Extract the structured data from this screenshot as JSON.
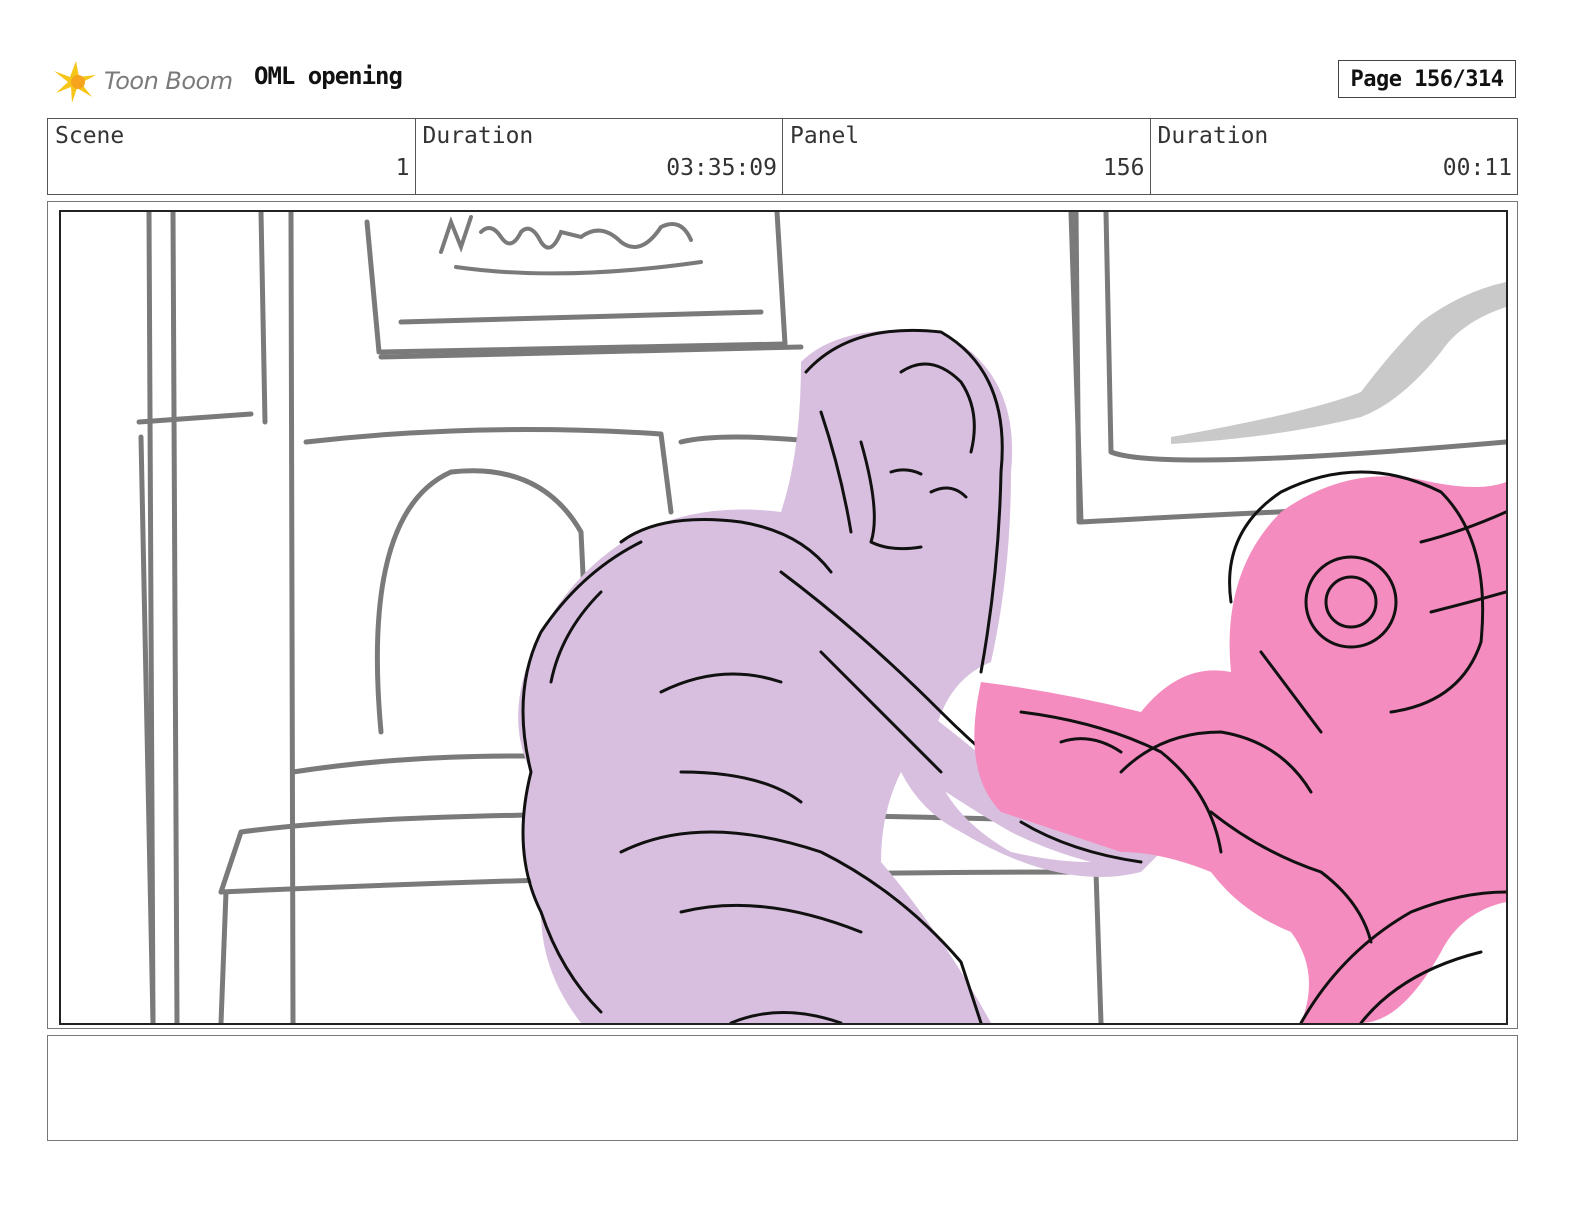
{
  "header": {
    "logo_text": "Toon Boom",
    "logo_icon": "toon-boom-burst-icon",
    "project_title": "OML opening",
    "page_label": "Page 156/314"
  },
  "info": [
    {
      "label": "Scene",
      "value": "1"
    },
    {
      "label": "Duration",
      "value": "03:35:09"
    },
    {
      "label": "Panel",
      "value": "156"
    },
    {
      "label": "Duration",
      "value": "00:11"
    }
  ],
  "panel": {
    "sign_text": "No Smiles",
    "colors": {
      "sketch_gray": "#7a7a7a",
      "lilac": "#d8bfdf",
      "pink": "#f48cbf",
      "ink": "#111111"
    }
  },
  "caption": {
    "text": ""
  }
}
